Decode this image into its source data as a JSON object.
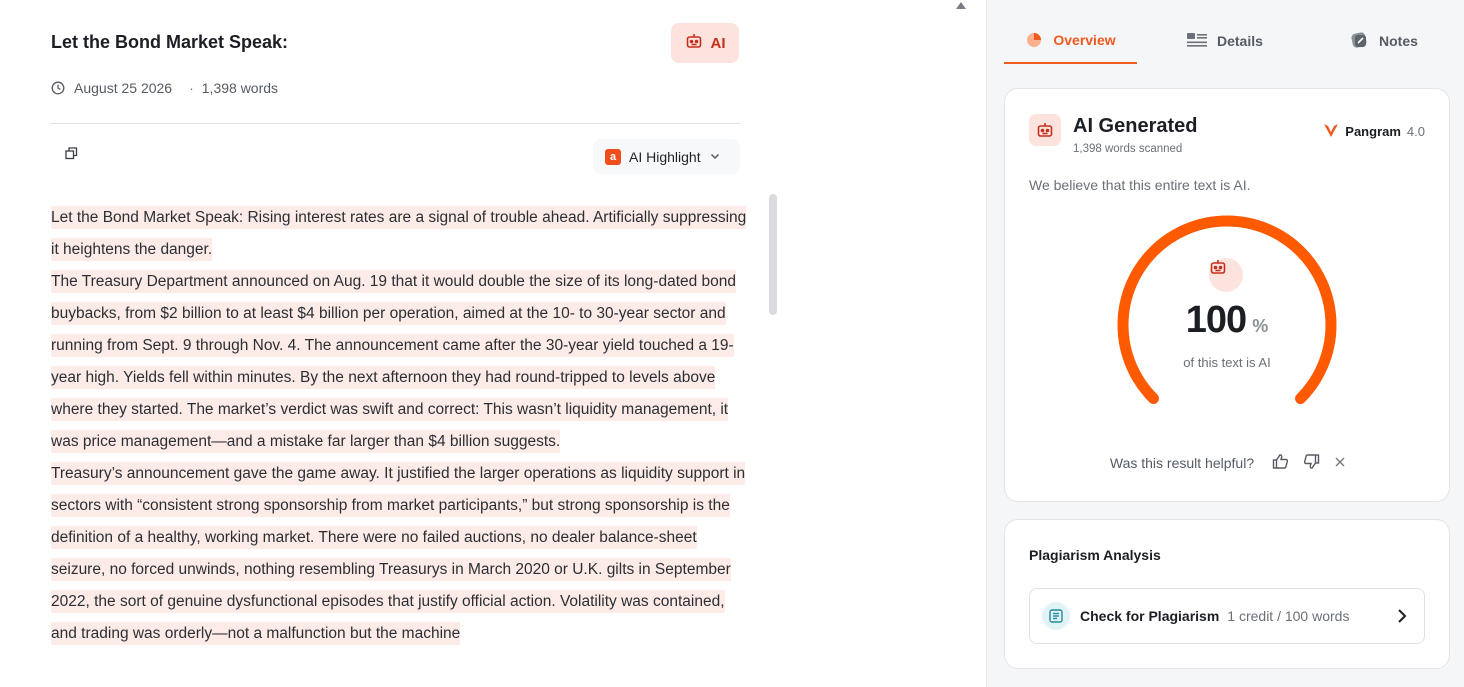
{
  "document": {
    "title": "Let the Bond Market Speak:",
    "ai_badge_label": "AI",
    "date": "August 25 2026",
    "separator": "·",
    "word_count": "1,398 words",
    "highlight_menu_label": "AI Highlight",
    "highlight_color": "#fdebe7",
    "paragraphs": [
      "Let the Bond Market Speak: Rising interest rates are a signal of trouble ahead. Artificially suppressing it heightens the danger.",
      "The Treasury Department announced on Aug. 19 that it would double the size of its long-dated bond buybacks, from $2 billion to at least $4 billion per operation, aimed at the 10- to 30-year sector and running from Sept. 9 through Nov. 4. The announcement came after the 30-year yield touched a 19-year high. Yields fell within minutes. By the next afternoon they had round-tripped to levels above where they started. The market’s verdict was swift and correct: This wasn’t liquidity management, it was price management—and a mistake far larger than $4 billion suggests.",
      "Treasury’s announcement gave the game away. It justified the larger operations as liquidity support in sectors with “consistent strong sponsorship from market participants,” but strong sponsorship is the definition of a healthy, working market. There were no failed auctions, no dealer balance-sheet seizure, no forced unwinds, nothing resembling Treasurys in March 2020 or U.K. gilts in September 2022, the sort of genuine dysfunctional episodes that justify official action. Volatility was contained, and trading was orderly—not a malfunction but the machine"
    ]
  },
  "sidebar": {
    "tabs": [
      {
        "label": "Overview",
        "icon": "overview-icon",
        "active": true
      },
      {
        "label": "Details",
        "icon": "details-icon",
        "active": false
      },
      {
        "label": "Notes",
        "icon": "notes-icon",
        "active": false
      }
    ],
    "result": {
      "title": "AI Generated",
      "words_scanned": "1,398 words scanned",
      "brand_name": "Pangram",
      "brand_version": "4.0",
      "statement": "We believe that this entire text is AI.",
      "percent_value": "100",
      "percent_sign": "%",
      "percent_fraction": 1.0,
      "percent_caption": "of this text is AI",
      "helpful_question": "Was this result helpful?"
    },
    "plagiarism": {
      "title": "Plagiarism Analysis",
      "button_label": "Check for Plagiarism",
      "credit_text": "1 credit / 100 words"
    }
  },
  "colors": {
    "accent": "#ee5a1f",
    "gauge": "#ff5a00",
    "ai_badge_bg": "#fde3de"
  }
}
